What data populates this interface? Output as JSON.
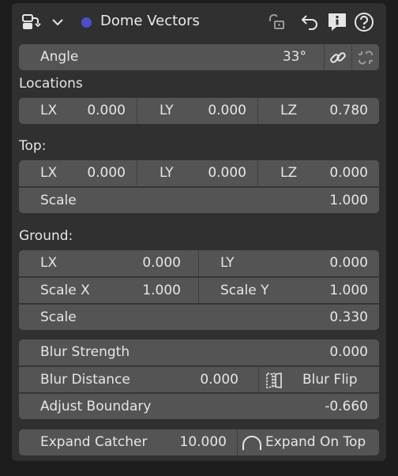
{
  "header": {
    "title": "Dome Vectors",
    "dot_color": "#4d4dd0"
  },
  "angle": {
    "label": "Angle",
    "value": "33°"
  },
  "locations": {
    "title": "Locations",
    "lx_label": "LX",
    "lx_value": "0.000",
    "ly_label": "LY",
    "ly_value": "0.000",
    "lz_label": "LZ",
    "lz_value": "0.780"
  },
  "top": {
    "title": "Top:",
    "lx_label": "LX",
    "lx_value": "0.000",
    "ly_label": "LY",
    "ly_value": "0.000",
    "lz_label": "LZ",
    "lz_value": "0.000",
    "scale_label": "Scale",
    "scale_value": "1.000"
  },
  "ground": {
    "title": "Ground:",
    "lx_label": "LX",
    "lx_value": "0.000",
    "ly_label": "LY",
    "ly_value": "0.000",
    "scalex_label": "Scale X",
    "scalex_value": "1.000",
    "scaley_label": "Scale Y",
    "scaley_value": "1.000",
    "scale_label": "Scale",
    "scale_value": "0.330"
  },
  "blur": {
    "strength_label": "Blur Strength",
    "strength_value": "0.000",
    "distance_label": "Blur Distance",
    "distance_value": "0.000",
    "flip_label": "Blur Flip",
    "boundary_label": "Adjust Boundary",
    "boundary_value": "-0.660"
  },
  "expand": {
    "catcher_label": "Expand Catcher",
    "catcher_value": "10.000",
    "ontop_label": "Expand On Top"
  }
}
